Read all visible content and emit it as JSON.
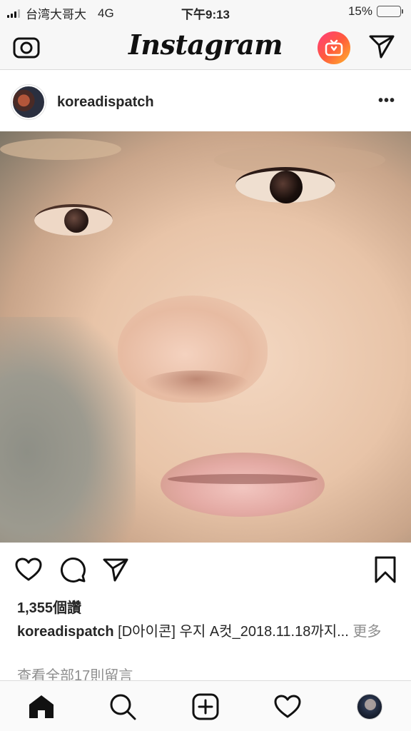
{
  "status_bar": {
    "carrier": "台湾大哥大",
    "network": "4G",
    "time": "下午9:13",
    "battery_text": "15%",
    "battery_level": 0.15,
    "battery_color": "#f2c200"
  },
  "top_nav": {
    "logo": "Instagram",
    "camera_icon": "camera-icon",
    "igtv_icon": "igtv-icon",
    "direct_icon": "paper-plane-icon"
  },
  "post": {
    "username": "koreadispatch",
    "more_label": "•••",
    "likes": "1,355個讚",
    "caption_user": "koreadispatch",
    "caption_text": " [D아이콘] 우지 A컷_2018.11.18까지... ",
    "caption_more": "更多",
    "view_comments": "查看全部17則留言"
  },
  "actions": {
    "like_icon": "heart-icon",
    "comment_icon": "comment-icon",
    "share_icon": "paper-plane-icon",
    "save_icon": "bookmark-icon"
  },
  "tab_bar": {
    "items": [
      "home-icon",
      "search-icon",
      "add-icon",
      "heart-icon",
      "profile-avatar"
    ]
  },
  "colors": {
    "text": "#262626",
    "muted": "#8e8e8e",
    "divider": "#dbdbdb",
    "igtv_gradient": [
      "#ff3d7f",
      "#ff5a3c",
      "#ffb52b"
    ]
  }
}
